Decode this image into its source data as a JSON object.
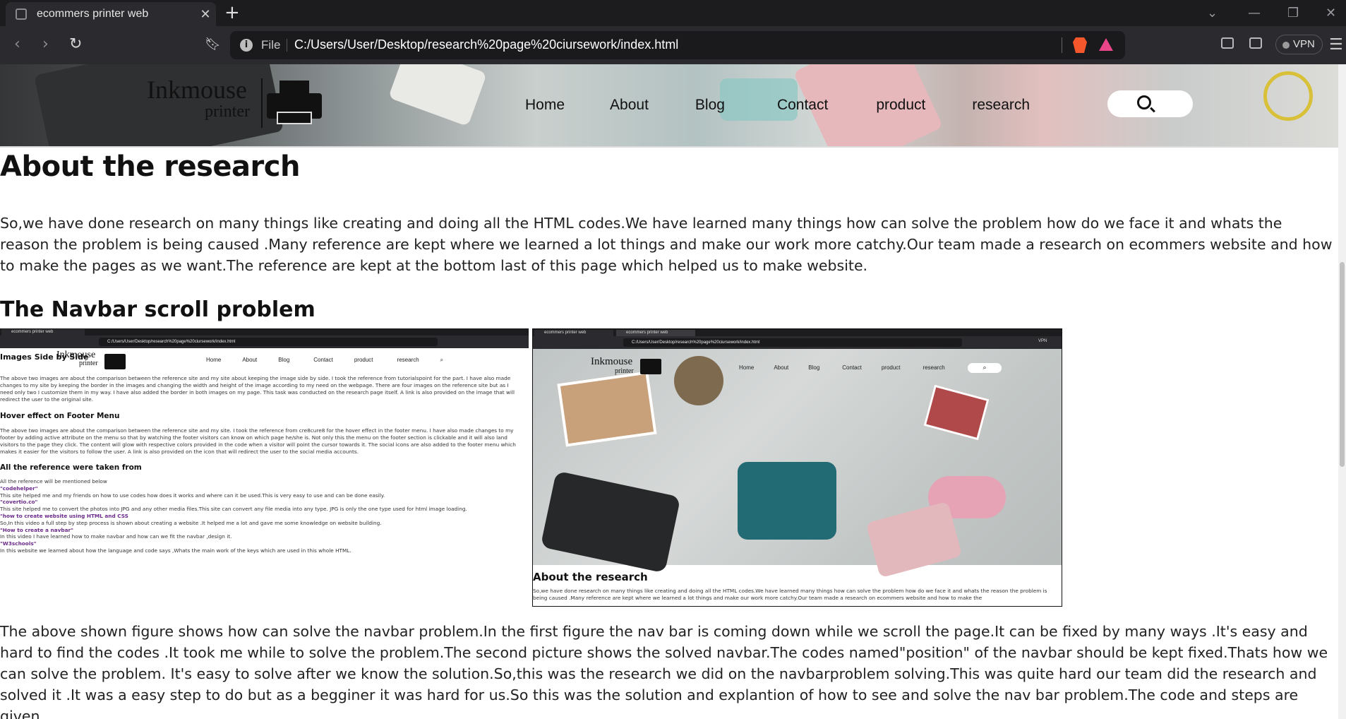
{
  "browser": {
    "tab_title": "ecommers printer web",
    "tab_close": "✕",
    "new_tab": "+",
    "file_label": "File",
    "url": "C:/Users/User/Desktop/research%20page%20ciursework/index.html",
    "vpn_label": "VPN"
  },
  "site": {
    "logo_main": "Inkmouse",
    "logo_sub": "printer",
    "nav": [
      "Home",
      "About",
      "Blog",
      "Contact",
      "product",
      "research"
    ]
  },
  "article": {
    "title": "About the research",
    "intro": "So,we have done research on many things like creating and doing all the HTML codes.We have learned many things how can solve the problem how do we face it and whats the reason the problem is being caused .Many reference are kept where we learned a lot things and make our work more catchy.Our team made a research on ecommers website and how to make the pages as we want.The reference are kept at the bottom last of this page which helped us to make website.",
    "subtitle": "The Navbar scroll problem",
    "explanation": "The above shown figure shows how can solve the navbar problem.In the first figure the nav bar is coming down while we scroll the page.It can be fixed by many ways .It's easy and hard to find the codes .It took me while to solve the problem.The second picture shows the solved navbar.The codes named\"position\" of the navbar should be kept fixed.Thats how we can solve the problem. It's easy to solve after we know the solution.So,this was the research we did on the navbarproblem solving.This was quite hard our team did the research and solved it .It was a easy step to do but as a begginer it was hard for us.So this was the solution and explantion of how to see and solve the nav bar problem.The code and steps are given."
  },
  "figure1": {
    "tab": "ecommers printer web",
    "url": "C:/Users/User/Desktop/research%20page%20ciursework/index.html",
    "heading1": "Images Side by Side",
    "text1": "The above two images are about the comparison between the reference site and my site about keeping the image side by side. I took the reference from tutorialspoint for the part. I have also made changes to my site by keeping the border in the images and changing the width and height of the image according to my need on the webpage. There are four images on the reference site but as I need only two I customize them in my way. I have also added the border in both images on my page. This task was conducted on the research page itself. A link is also provided on the image that will redirect the user to the original site.",
    "heading2": "Hover effect on Footer Menu",
    "text2": "The above two images are about the comparison between the reference site and my site. I took the reference from cre8cure8 for the hover effect in the footer menu. I have also made changes to my footer by adding active attribute on the menu so that by watching the footer visitors can know on which page he/she is. Not only this the menu on the footer section is clickable and it will also land visitors to the page they click. The content will glow with respective colors provided in the code when a visitor will point the cursor towards it. The social icons are also added to the footer menu which makes it easier for the visitors to follow the user. A link is also provided on the icon that will redirect the user to the social media accounts.",
    "heading3": "All the reference were taken from",
    "refs": [
      "All the reference will be mentioned below",
      "\"codehelper\"",
      "This site helped me and my friends on how to use codes how does it works and where can it be used.This is very easy to use and can be done easily.",
      "\"covertio.co\"",
      "This site helped me to convert the photos into JPG and any other media files.This site can convert any file media into any type. JPG is only the one type used for html image loading.",
      "\"how to create website using HTML and CSS",
      "So,In this video a full step by step process is shown about creating a website .It helped me a lot and gave me some knowledge on website building.",
      "\"How to create a navbar\"",
      "In this video I have learned how to make navbar and how can we fit the navbar ,design it.",
      "\"W3schools\"",
      "In this website we learned about how the language and code says ,Whats the main work of the keys which are used in this whole HTML."
    ]
  },
  "figure2": {
    "tab1": "ecommers printer web",
    "tab2": "ecommers printer web",
    "url": "C:/Users/User/Desktop/research%20page%20ciursework/index.html",
    "vpn": "VPN",
    "heading": "About the research",
    "text": "So,we have done research on many things like creating and doing all the HTML codes.We have learned many things how can solve the problem how do we face it and whats the reason the problem is being caused .Many reference are kept where we learned a lot things and make our work more catchy.Our team made a research on ecommers website and how to make the"
  },
  "colors": {
    "chrome_dark": "#1c1c1f",
    "chrome_toolbar": "#2b2b2f",
    "text_dark": "#111111",
    "ref_link": "#6b2a8a"
  }
}
